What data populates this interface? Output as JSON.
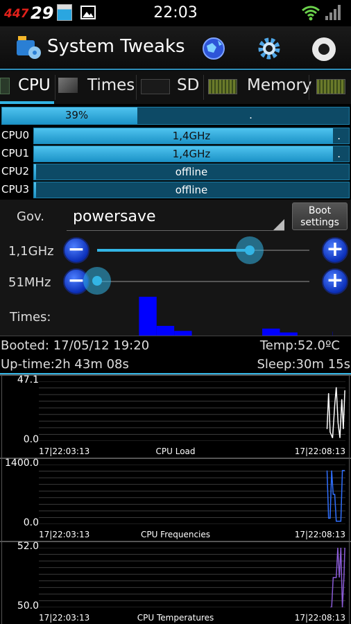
{
  "status_bar": {
    "time": "22:03",
    "left_badge": "447",
    "date_badge": "29"
  },
  "action_bar": {
    "title": "System Tweaks",
    "icons": [
      "app-icon",
      "globe-icon",
      "gear-icon",
      "record-icon"
    ]
  },
  "tabs": [
    {
      "label": "CPU",
      "selected": true
    },
    {
      "label": "Times",
      "selected": false
    },
    {
      "label": "SD",
      "selected": false
    },
    {
      "label": "Memory",
      "selected": false
    }
  ],
  "overall": {
    "label": "39%",
    "value": 0.39,
    "mark": "."
  },
  "cpus": [
    {
      "name": "CPU0",
      "label": "1,4GHz",
      "value": 0.95,
      "mark": "."
    },
    {
      "name": "CPU1",
      "label": "1,4GHz",
      "value": 0.95,
      "mark": "."
    },
    {
      "name": "CPU2",
      "label": "offline",
      "value": 0.0,
      "mark": ""
    },
    {
      "name": "CPU3",
      "label": "offline",
      "value": 0.0,
      "mark": ""
    }
  ],
  "governor": {
    "label": "Gov.",
    "value": "powersave",
    "boot_button": "Boot settings",
    "max": {
      "label": "1,1GHz",
      "position": 0.72
    },
    "min": {
      "label": "51MHz",
      "position": 0.0
    },
    "minus": "−",
    "plus": "+",
    "times_label": "Times:",
    "times_values": [
      0,
      1.0,
      0.25,
      0.12,
      0.0,
      0.0,
      0.0,
      0.0,
      0.18,
      0.08,
      0.0,
      0.0,
      0.1
    ]
  },
  "info": {
    "booted": "Booted:  17/05/12 19:20",
    "temp": "Temp:52.0ºC",
    "uptime": "Up-time:2h 43m 08s",
    "sleep": "Sleep:30m 15s"
  },
  "graphs": [
    {
      "title": "CPU Load",
      "ymax": "47.1",
      "ymin": "0.0",
      "start": "17|22:03:13",
      "end": "17|22:08:13",
      "color": "#ffffff"
    },
    {
      "title": "CPU Frequencies",
      "ymax": "1400.0",
      "ymin": "0.0",
      "start": "17|22:03:13",
      "end": "17|22:08:13",
      "color": "#2f6fff"
    },
    {
      "title": "CPU Temperatures",
      "ymax": "52.0",
      "ymin": "50.0",
      "start": "17|22:03:13",
      "end": "17|22:08:13",
      "color": "#8a5cd6"
    }
  ],
  "colors": {
    "accent": "#33b5e5",
    "button": "#1b3fd8",
    "times_bar": "#0000ff"
  }
}
